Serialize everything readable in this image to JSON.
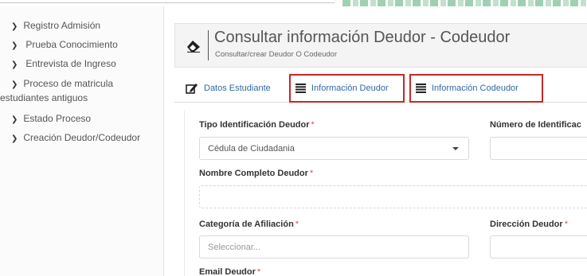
{
  "sidebar": {
    "items": [
      {
        "label": "Registro Admisión"
      },
      {
        "label": "Prueba Conocimiento"
      },
      {
        "label": "Entrevista de Ingreso"
      },
      {
        "label_line1": "Proceso de matricula",
        "label_line2": "estudiantes antiguos"
      },
      {
        "label": "Estado Proceso"
      },
      {
        "label": "Creación Deudor/Codeudor"
      }
    ]
  },
  "header": {
    "title": "Consultar información Deudor - Codeudor",
    "subtitle": "Consultar/crear Deudor O Codeudor",
    "icon": "eraser-icon"
  },
  "tabs": [
    {
      "label": "Datos Estudiante",
      "icon": "edit-icon",
      "highlighted": false
    },
    {
      "label": "Información Deudor",
      "icon": "list-icon",
      "highlighted": true
    },
    {
      "label": "Información Codeudor",
      "icon": "list-icon",
      "highlighted": true
    }
  ],
  "form": {
    "tipo_id_label": "Tipo Identificación Deudor",
    "tipo_id_value": "Cédula de Ciudadania",
    "numero_id_label": "Número de Identificac",
    "numero_id_value": "",
    "nombre_label": "Nombre Completo Deudor",
    "nombre_value": "",
    "categoria_label": "Categoría de Afiliación",
    "categoria_placeholder": "Seleccionar...",
    "direccion_label": "Dirección Deudor",
    "direccion_value": "",
    "email_label": "Email Deudor",
    "required_mark": "*"
  },
  "colors": {
    "tab_text": "#2f6aa3",
    "highlight_border": "#c62828",
    "required": "#d9534f"
  }
}
